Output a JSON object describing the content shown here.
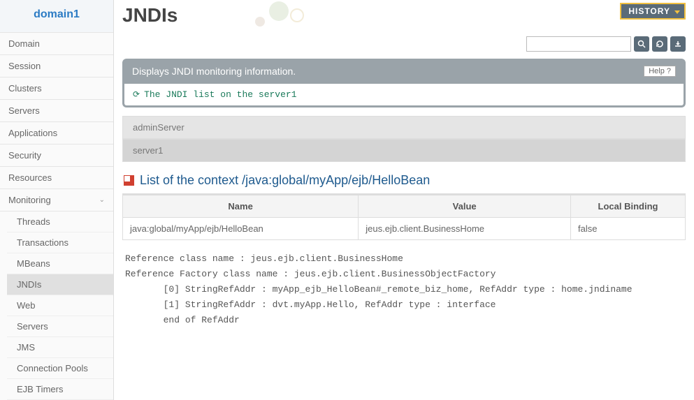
{
  "sidebar": {
    "domain": "domain1",
    "items": [
      "Domain",
      "Session",
      "Clusters",
      "Servers",
      "Applications",
      "Security",
      "Resources"
    ],
    "monitoring_label": "Monitoring",
    "monitoring_items": [
      "Threads",
      "Transactions",
      "MBeans",
      "JNDIs",
      "Web",
      "Servers",
      "JMS",
      "Connection Pools",
      "EJB Timers"
    ]
  },
  "header": {
    "history": "HISTORY",
    "title": "JNDIs",
    "search_placeholder": ""
  },
  "info": {
    "desc": "Displays JNDI monitoring information.",
    "help": "Help",
    "message": "The JNDI list on the server1"
  },
  "servers": {
    "tabs": [
      "adminServer",
      "server1"
    ]
  },
  "section": {
    "title": "List of the context /java:global/myApp/ejb/HelloBean"
  },
  "table": {
    "headers": [
      "Name",
      "Value",
      "Local Binding"
    ],
    "row": {
      "name": "java:global/myApp/ejb/HelloBean",
      "value": "jeus.ejb.client.BusinessHome",
      "local": "false"
    }
  },
  "ref": {
    "l1": "Reference class name : jeus.ejb.client.BusinessHome",
    "l2": "Reference Factory class name : jeus.ejb.client.BusinessObjectFactory",
    "l3": "       [0] StringRefAddr : myApp_ejb_HelloBean#_remote_biz_home, RefAddr type : home.jndiname",
    "l4": "       [1] StringRefAddr : dvt.myApp.Hello, RefAddr type : interface",
    "l5": "       end of RefAddr"
  }
}
